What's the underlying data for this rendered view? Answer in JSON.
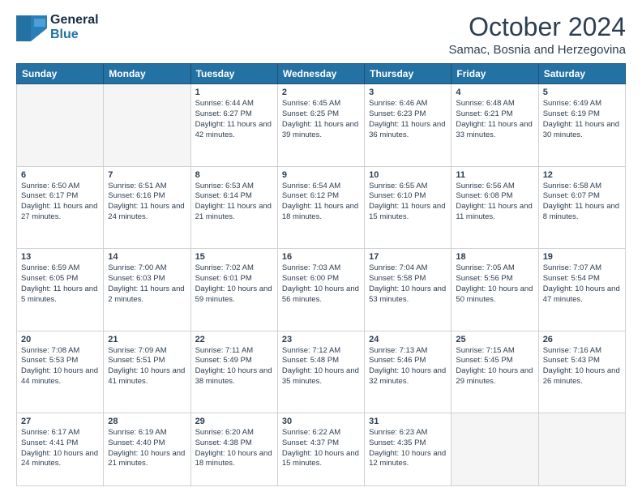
{
  "header": {
    "logo_general": "General",
    "logo_blue": "Blue",
    "month_title": "October 2024",
    "location": "Samac, Bosnia and Herzegovina"
  },
  "days_of_week": [
    "Sunday",
    "Monday",
    "Tuesday",
    "Wednesday",
    "Thursday",
    "Friday",
    "Saturday"
  ],
  "weeks": [
    [
      {
        "day": "",
        "sunrise": "",
        "sunset": "",
        "daylight": ""
      },
      {
        "day": "",
        "sunrise": "",
        "sunset": "",
        "daylight": ""
      },
      {
        "day": "1",
        "sunrise": "Sunrise: 6:44 AM",
        "sunset": "Sunset: 6:27 PM",
        "daylight": "Daylight: 11 hours and 42 minutes."
      },
      {
        "day": "2",
        "sunrise": "Sunrise: 6:45 AM",
        "sunset": "Sunset: 6:25 PM",
        "daylight": "Daylight: 11 hours and 39 minutes."
      },
      {
        "day": "3",
        "sunrise": "Sunrise: 6:46 AM",
        "sunset": "Sunset: 6:23 PM",
        "daylight": "Daylight: 11 hours and 36 minutes."
      },
      {
        "day": "4",
        "sunrise": "Sunrise: 6:48 AM",
        "sunset": "Sunset: 6:21 PM",
        "daylight": "Daylight: 11 hours and 33 minutes."
      },
      {
        "day": "5",
        "sunrise": "Sunrise: 6:49 AM",
        "sunset": "Sunset: 6:19 PM",
        "daylight": "Daylight: 11 hours and 30 minutes."
      }
    ],
    [
      {
        "day": "6",
        "sunrise": "Sunrise: 6:50 AM",
        "sunset": "Sunset: 6:17 PM",
        "daylight": "Daylight: 11 hours and 27 minutes."
      },
      {
        "day": "7",
        "sunrise": "Sunrise: 6:51 AM",
        "sunset": "Sunset: 6:16 PM",
        "daylight": "Daylight: 11 hours and 24 minutes."
      },
      {
        "day": "8",
        "sunrise": "Sunrise: 6:53 AM",
        "sunset": "Sunset: 6:14 PM",
        "daylight": "Daylight: 11 hours and 21 minutes."
      },
      {
        "day": "9",
        "sunrise": "Sunrise: 6:54 AM",
        "sunset": "Sunset: 6:12 PM",
        "daylight": "Daylight: 11 hours and 18 minutes."
      },
      {
        "day": "10",
        "sunrise": "Sunrise: 6:55 AM",
        "sunset": "Sunset: 6:10 PM",
        "daylight": "Daylight: 11 hours and 15 minutes."
      },
      {
        "day": "11",
        "sunrise": "Sunrise: 6:56 AM",
        "sunset": "Sunset: 6:08 PM",
        "daylight": "Daylight: 11 hours and 11 minutes."
      },
      {
        "day": "12",
        "sunrise": "Sunrise: 6:58 AM",
        "sunset": "Sunset: 6:07 PM",
        "daylight": "Daylight: 11 hours and 8 minutes."
      }
    ],
    [
      {
        "day": "13",
        "sunrise": "Sunrise: 6:59 AM",
        "sunset": "Sunset: 6:05 PM",
        "daylight": "Daylight: 11 hours and 5 minutes."
      },
      {
        "day": "14",
        "sunrise": "Sunrise: 7:00 AM",
        "sunset": "Sunset: 6:03 PM",
        "daylight": "Daylight: 11 hours and 2 minutes."
      },
      {
        "day": "15",
        "sunrise": "Sunrise: 7:02 AM",
        "sunset": "Sunset: 6:01 PM",
        "daylight": "Daylight: 10 hours and 59 minutes."
      },
      {
        "day": "16",
        "sunrise": "Sunrise: 7:03 AM",
        "sunset": "Sunset: 6:00 PM",
        "daylight": "Daylight: 10 hours and 56 minutes."
      },
      {
        "day": "17",
        "sunrise": "Sunrise: 7:04 AM",
        "sunset": "Sunset: 5:58 PM",
        "daylight": "Daylight: 10 hours and 53 minutes."
      },
      {
        "day": "18",
        "sunrise": "Sunrise: 7:05 AM",
        "sunset": "Sunset: 5:56 PM",
        "daylight": "Daylight: 10 hours and 50 minutes."
      },
      {
        "day": "19",
        "sunrise": "Sunrise: 7:07 AM",
        "sunset": "Sunset: 5:54 PM",
        "daylight": "Daylight: 10 hours and 47 minutes."
      }
    ],
    [
      {
        "day": "20",
        "sunrise": "Sunrise: 7:08 AM",
        "sunset": "Sunset: 5:53 PM",
        "daylight": "Daylight: 10 hours and 44 minutes."
      },
      {
        "day": "21",
        "sunrise": "Sunrise: 7:09 AM",
        "sunset": "Sunset: 5:51 PM",
        "daylight": "Daylight: 10 hours and 41 minutes."
      },
      {
        "day": "22",
        "sunrise": "Sunrise: 7:11 AM",
        "sunset": "Sunset: 5:49 PM",
        "daylight": "Daylight: 10 hours and 38 minutes."
      },
      {
        "day": "23",
        "sunrise": "Sunrise: 7:12 AM",
        "sunset": "Sunset: 5:48 PM",
        "daylight": "Daylight: 10 hours and 35 minutes."
      },
      {
        "day": "24",
        "sunrise": "Sunrise: 7:13 AM",
        "sunset": "Sunset: 5:46 PM",
        "daylight": "Daylight: 10 hours and 32 minutes."
      },
      {
        "day": "25",
        "sunrise": "Sunrise: 7:15 AM",
        "sunset": "Sunset: 5:45 PM",
        "daylight": "Daylight: 10 hours and 29 minutes."
      },
      {
        "day": "26",
        "sunrise": "Sunrise: 7:16 AM",
        "sunset": "Sunset: 5:43 PM",
        "daylight": "Daylight: 10 hours and 26 minutes."
      }
    ],
    [
      {
        "day": "27",
        "sunrise": "Sunrise: 6:17 AM",
        "sunset": "Sunset: 4:41 PM",
        "daylight": "Daylight: 10 hours and 24 minutes."
      },
      {
        "day": "28",
        "sunrise": "Sunrise: 6:19 AM",
        "sunset": "Sunset: 4:40 PM",
        "daylight": "Daylight: 10 hours and 21 minutes."
      },
      {
        "day": "29",
        "sunrise": "Sunrise: 6:20 AM",
        "sunset": "Sunset: 4:38 PM",
        "daylight": "Daylight: 10 hours and 18 minutes."
      },
      {
        "day": "30",
        "sunrise": "Sunrise: 6:22 AM",
        "sunset": "Sunset: 4:37 PM",
        "daylight": "Daylight: 10 hours and 15 minutes."
      },
      {
        "day": "31",
        "sunrise": "Sunrise: 6:23 AM",
        "sunset": "Sunset: 4:35 PM",
        "daylight": "Daylight: 10 hours and 12 minutes."
      },
      {
        "day": "",
        "sunrise": "",
        "sunset": "",
        "daylight": ""
      },
      {
        "day": "",
        "sunrise": "",
        "sunset": "",
        "daylight": ""
      }
    ]
  ]
}
